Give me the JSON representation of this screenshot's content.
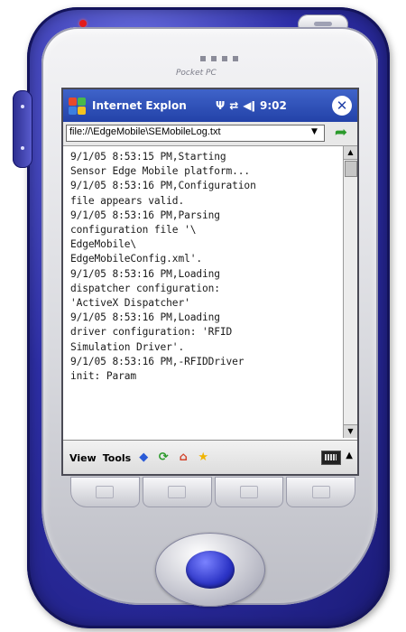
{
  "device": {
    "brand": "Pocket PC",
    "colors": {
      "body": "#2e2fa8",
      "bezel": "#d9dadf",
      "led": "#e31b1b"
    }
  },
  "titlebar": {
    "start_icon": "windows-flag-icon",
    "title": "Internet Explon",
    "icons": [
      "antenna-icon",
      "sync-arrows-icon",
      "speaker-icon"
    ],
    "time": "9:02",
    "close_label": "✕",
    "color": "#2342a8"
  },
  "address": {
    "value": "file://\\EdgeMobile\\SEMobileLog.txt",
    "dropdown_icon": "chevron-down-icon",
    "go_icon": "go-arrow-icon"
  },
  "log": {
    "lines": [
      "9/1/05 8:53:15 PM,Starting",
      "Sensor Edge Mobile platform...",
      "9/1/05 8:53:16 PM,Configuration",
      "file appears valid.",
      "9/1/05 8:53:16 PM,Parsing",
      "configuration file '\\",
      "EdgeMobile\\",
      "EdgeMobileConfig.xml'.",
      "9/1/05 8:53:16 PM,Loading",
      "dispatcher configuration:",
      "'ActiveX Dispatcher'",
      "9/1/05 8:53:16 PM,Loading",
      "driver configuration: 'RFID",
      "Simulation Driver'.",
      "9/1/05 8:53:16 PM,-RFIDDriver",
      "init: Param"
    ]
  },
  "menubar": {
    "view": "View",
    "tools": "Tools",
    "icons": [
      "back-icon",
      "refresh-icon",
      "home-icon",
      "favorites-icon"
    ],
    "keyboard_icon": "keyboard-icon",
    "keyboard_up": "▲"
  },
  "scrollbar": {
    "up": "▲",
    "down": "▼"
  }
}
